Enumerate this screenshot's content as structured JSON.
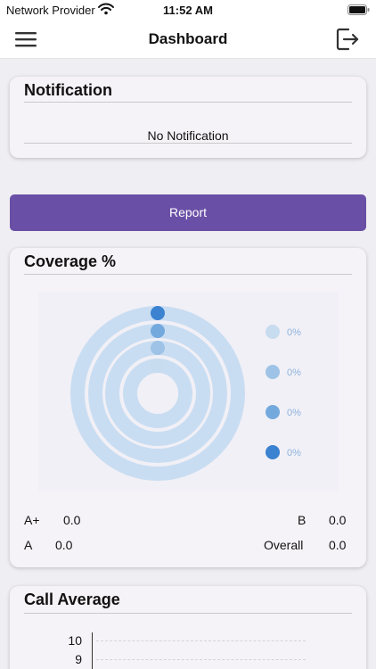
{
  "status_bar": {
    "provider": "Network Provider",
    "time": "11:52 AM"
  },
  "nav": {
    "title": "Dashboard",
    "menu_icon": "hamburger-menu-icon",
    "logout_icon": "logout-icon"
  },
  "notification": {
    "title": "Notification",
    "empty_text": "No Notification"
  },
  "report_button": {
    "label": "Report"
  },
  "coverage": {
    "title": "Coverage %",
    "legend": [
      "0%",
      "0%",
      "0%",
      "0%"
    ],
    "colors": {
      "track": "#c9ddf2",
      "legend_dots": [
        "#c8dcef",
        "#9ec3e6",
        "#74a9de",
        "#3b82d0"
      ],
      "legend_text": "#8eb4dc"
    },
    "stats": {
      "a_plus_label": "A+",
      "a_plus_value": "0.0",
      "b_label": "B",
      "b_value": "0.0",
      "a_label": "A",
      "a_value": "0.0",
      "overall_label": "Overall",
      "overall_value": "0.0"
    },
    "chart_data": {
      "type": "radial-bar",
      "series": [
        {
          "name": "A+",
          "value": 0
        },
        {
          "name": "A",
          "value": 0
        },
        {
          "name": "B",
          "value": 0
        },
        {
          "name": "Overall",
          "value": 0
        }
      ],
      "legend_labels": [
        "0%",
        "0%",
        "0%",
        "0%"
      ]
    }
  },
  "call_average": {
    "title": "Call Average",
    "chart_data": {
      "type": "bar",
      "y_ticks": [
        "10",
        "9"
      ],
      "values": []
    }
  }
}
